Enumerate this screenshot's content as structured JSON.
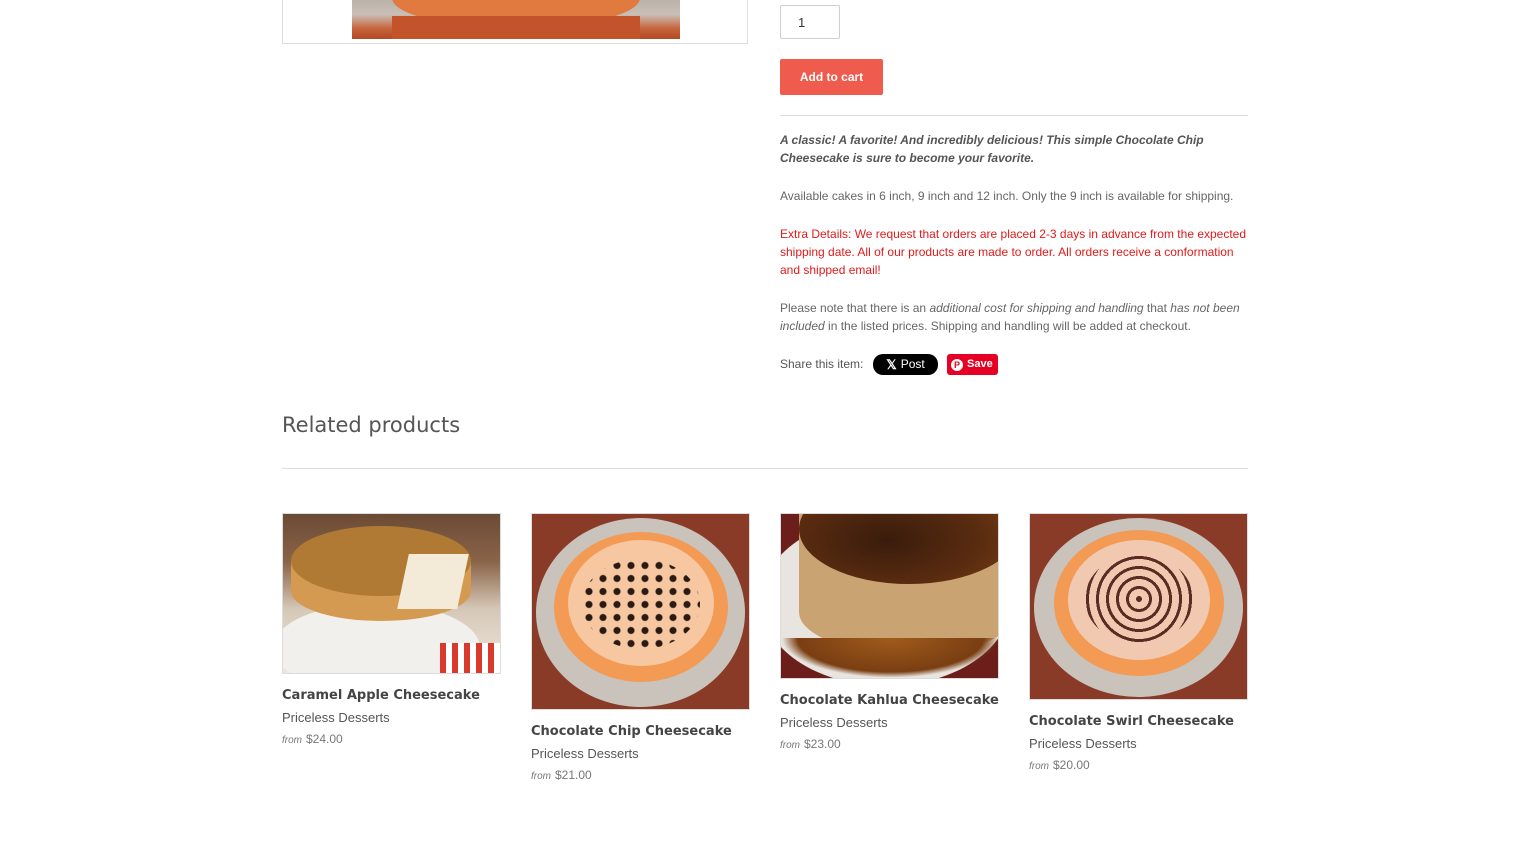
{
  "product": {
    "quantity": "1",
    "add_to_cart_label": "Add to cart",
    "description": {
      "intro": "A classic! A favorite! And incredibly delicious! This simple Chocolate Chip Cheesecake is sure to become your favorite.",
      "sizes": "Available cakes in 6 inch, 9 inch and 12 inch. Only the 9 inch is available for shipping.",
      "extra_details": "Extra Details: We request that orders are placed 2-3 days in advance from the expected shipping date. All of our products are made to order. All orders receive a conformation and shipped email!",
      "shipping_note": {
        "part1": "Please note that there is an ",
        "emph1": "additional cost for shipping and handling",
        "part2": " that ",
        "emph2": "has not been included",
        "part3": " in the listed prices. Shipping and handling will be added at checkout."
      }
    },
    "share": {
      "label": "Share this item:",
      "x_post_label": "Post",
      "x_icon": "x-logo-icon",
      "pinterest_save_label": "Save",
      "pinterest_icon": "pinterest-icon"
    }
  },
  "related": {
    "title": "Related products",
    "items": [
      {
        "title": "Caramel Apple Cheesecake",
        "vendor": "Priceless Desserts",
        "from_label": "from",
        "price": "$24.00"
      },
      {
        "title": "Chocolate Chip Cheesecake",
        "vendor": "Priceless Desserts",
        "from_label": "from",
        "price": "$21.00"
      },
      {
        "title": "Chocolate Kahlua Cheesecake",
        "vendor": "Priceless Desserts",
        "from_label": "from",
        "price": "$23.00"
      },
      {
        "title": "Chocolate Swirl Cheesecake",
        "vendor": "Priceless Desserts",
        "from_label": "from",
        "price": "$20.00"
      }
    ]
  },
  "colors": {
    "accent": "#ef5b4d",
    "extra_details_text": "#e11a1a",
    "x_button": "#000000",
    "pinterest": "#e60023"
  }
}
